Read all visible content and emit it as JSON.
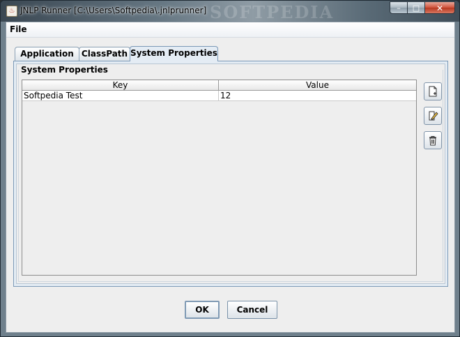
{
  "window": {
    "title": "JNLP Runner [C:\\Users\\Softpedia\\.jnlprunner]",
    "watermark": "SOFTPEDIA",
    "caption_minimize": "–",
    "caption_maximize": "□",
    "caption_close": "✕"
  },
  "menu": {
    "file": "File"
  },
  "tabs": [
    {
      "label": "Application",
      "selected": false
    },
    {
      "label": "ClassPath",
      "selected": false
    },
    {
      "label": "System Properties",
      "selected": true
    }
  ],
  "group": {
    "title": "System Properties"
  },
  "table": {
    "columns": [
      "Key",
      "Value"
    ],
    "rows": [
      {
        "key": "Softpedia Test",
        "value": "12"
      }
    ]
  },
  "side_buttons": [
    {
      "name": "new-property-button",
      "icon": "new-document-icon"
    },
    {
      "name": "edit-property-button",
      "icon": "edit-pencil-icon"
    },
    {
      "name": "delete-property-button",
      "icon": "trash-icon"
    }
  ],
  "buttons": {
    "ok": "OK",
    "cancel": "Cancel"
  }
}
